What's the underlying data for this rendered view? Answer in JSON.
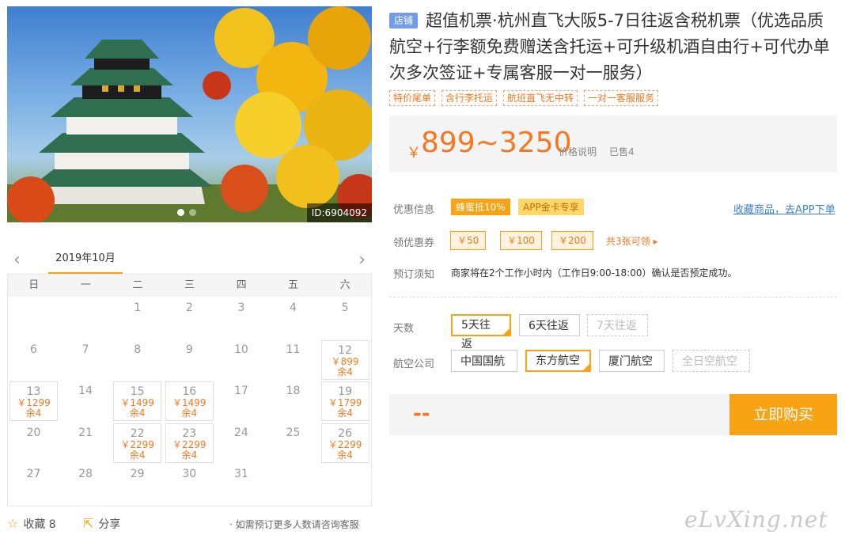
{
  "hero": {
    "image_id": "ID:6904092"
  },
  "calendar": {
    "month": "2019年10月",
    "weekdays": [
      "日",
      "一",
      "二",
      "三",
      "四",
      "五",
      "六"
    ],
    "days": [
      {
        "day": "1",
        "col": 2,
        "row": 0
      },
      {
        "day": "2",
        "col": 3,
        "row": 0
      },
      {
        "day": "3",
        "col": 4,
        "row": 0
      },
      {
        "day": "4",
        "col": 5,
        "row": 0
      },
      {
        "day": "5",
        "col": 6,
        "row": 0
      },
      {
        "day": "6",
        "col": 0,
        "row": 1
      },
      {
        "day": "7",
        "col": 1,
        "row": 1
      },
      {
        "day": "8",
        "col": 2,
        "row": 1
      },
      {
        "day": "9",
        "col": 3,
        "row": 1
      },
      {
        "day": "10",
        "col": 4,
        "row": 1
      },
      {
        "day": "11",
        "col": 5,
        "row": 1
      },
      {
        "day": "12",
        "col": 6,
        "row": 1,
        "price": "￥899",
        "remain": "余4"
      },
      {
        "day": "13",
        "col": 0,
        "row": 2,
        "price": "￥1299",
        "remain": "余4"
      },
      {
        "day": "14",
        "col": 1,
        "row": 2
      },
      {
        "day": "15",
        "col": 2,
        "row": 2,
        "price": "￥1499",
        "remain": "余4"
      },
      {
        "day": "16",
        "col": 3,
        "row": 2,
        "price": "￥1499",
        "remain": "余4"
      },
      {
        "day": "17",
        "col": 4,
        "row": 2
      },
      {
        "day": "18",
        "col": 5,
        "row": 2
      },
      {
        "day": "19",
        "col": 6,
        "row": 2,
        "price": "￥1799",
        "remain": "余4"
      },
      {
        "day": "20",
        "col": 0,
        "row": 3
      },
      {
        "day": "21",
        "col": 1,
        "row": 3
      },
      {
        "day": "22",
        "col": 2,
        "row": 3,
        "price": "￥2299",
        "remain": "余4"
      },
      {
        "day": "23",
        "col": 3,
        "row": 3,
        "price": "￥2299",
        "remain": "余4"
      },
      {
        "day": "24",
        "col": 4,
        "row": 3
      },
      {
        "day": "25",
        "col": 5,
        "row": 3
      },
      {
        "day": "26",
        "col": 6,
        "row": 3,
        "price": "￥2299",
        "remain": "余4"
      },
      {
        "day": "27",
        "col": 0,
        "row": 4
      },
      {
        "day": "28",
        "col": 1,
        "row": 4
      },
      {
        "day": "29",
        "col": 2,
        "row": 4
      },
      {
        "day": "30",
        "col": 3,
        "row": 4
      },
      {
        "day": "31",
        "col": 4,
        "row": 4
      }
    ]
  },
  "actions": {
    "favorite": "收藏 8",
    "share": "分享",
    "consult": "· 如需预订更多人数请咨询客服"
  },
  "watermark": "eLvXing.net",
  "title": {
    "shop_badge": "店铺",
    "text": "超值机票·杭州直飞大阪5-7日往返含税机票（优选品质航空+行李额免费赠送含托运+可升级机酒自由行+可代办单次多次签证+专属客服一对一服务）"
  },
  "tags": [
    "特价尾单",
    "含行李托运",
    "航班直飞无中转",
    "一对一客服服务"
  ],
  "price": {
    "currency": "￥",
    "range": "899~3250",
    "note": "价格说明",
    "sold": "已售4"
  },
  "promo": {
    "label": "优惠信息",
    "badge1": "蜂蜜抵10%",
    "badge2": "APP金卡专享",
    "link": "收藏商品，去APP下单"
  },
  "coupons": {
    "label": "领优惠券",
    "items": [
      "￥50",
      "￥100",
      "￥200"
    ],
    "more": "共3张可领 ▸"
  },
  "notice": {
    "label": "预订须知",
    "text": "商家将在2个工作小时内（工作日9:00-18:00）确认是否预定成功。"
  },
  "days_option": {
    "label": "天数",
    "options": [
      "5天往返",
      "6天往返",
      "7天往返"
    ]
  },
  "airline_option": {
    "label": "航空公司",
    "options": [
      "中国国航",
      "东方航空",
      "厦门航空",
      "全日空航空"
    ]
  },
  "buy": {
    "price_placeholder": "--",
    "button": "立即购买"
  },
  "colors": {
    "accent": "#f7a314",
    "price": "#f7771d",
    "link": "#3b82d6"
  }
}
